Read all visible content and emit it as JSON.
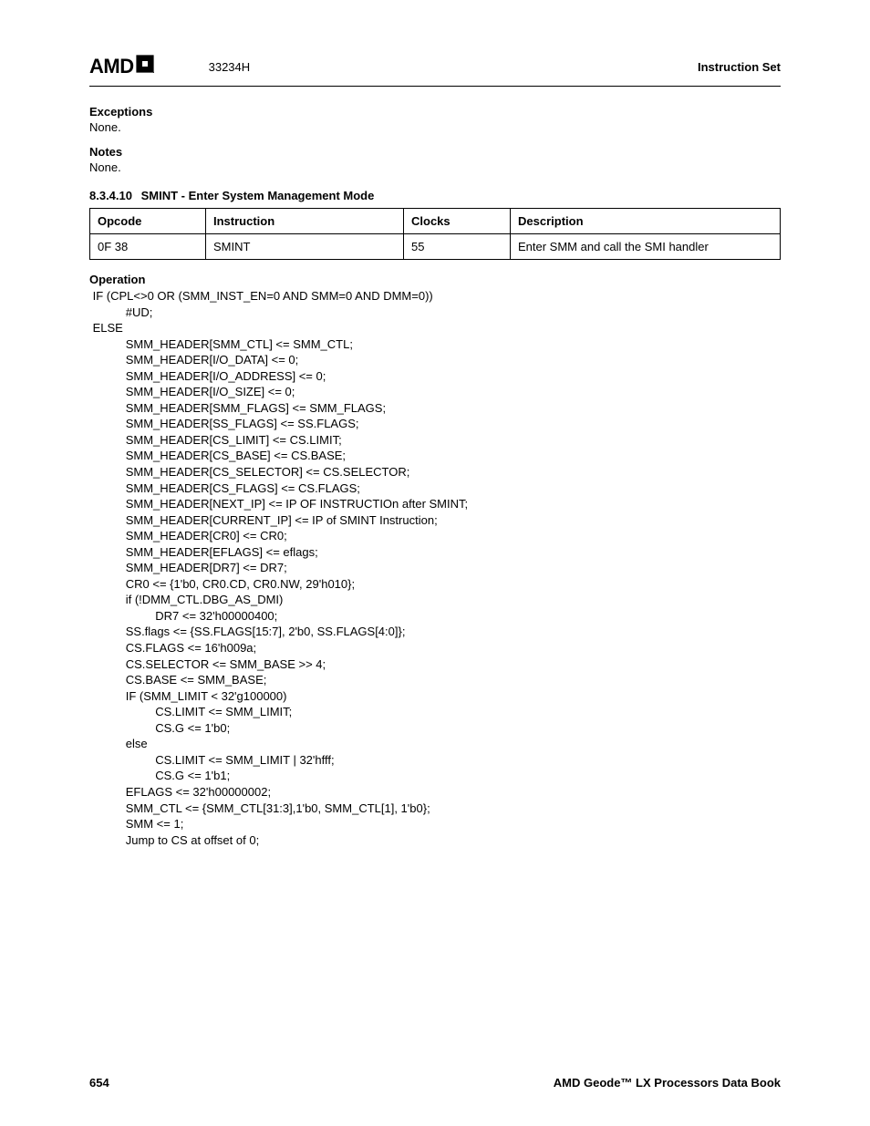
{
  "header": {
    "logo_text": "AMD",
    "doc_code": "33234H",
    "right": "Instruction Set"
  },
  "exceptions": {
    "heading": "Exceptions",
    "text": "None."
  },
  "notes": {
    "heading": "Notes",
    "text": "None."
  },
  "section": {
    "number": "8.3.4.10",
    "title": "SMINT - Enter System Management Mode"
  },
  "table": {
    "headers": {
      "opcode": "Opcode",
      "instruction": "Instruction",
      "clocks": "Clocks",
      "description": "Description"
    },
    "row": {
      "opcode": "0F 38",
      "instruction": "SMINT",
      "clocks": "55",
      "description": "Enter SMM and call the SMI handler"
    }
  },
  "operation": {
    "heading": "Operation",
    "code": " IF (CPL<>0 OR (SMM_INST_EN=0 AND SMM=0 AND DMM=0))\n           #UD;\n ELSE\n           SMM_HEADER[SMM_CTL] <= SMM_CTL;\n           SMM_HEADER[I/O_DATA] <= 0;\n           SMM_HEADER[I/O_ADDRESS] <= 0;\n           SMM_HEADER[I/O_SIZE] <= 0;\n           SMM_HEADER[SMM_FLAGS] <= SMM_FLAGS;\n           SMM_HEADER[SS_FLAGS] <= SS.FLAGS;\n           SMM_HEADER[CS_LIMIT] <= CS.LIMIT;\n           SMM_HEADER[CS_BASE] <= CS.BASE;\n           SMM_HEADER[CS_SELECTOR] <= CS.SELECTOR;\n           SMM_HEADER[CS_FLAGS] <= CS.FLAGS;\n           SMM_HEADER[NEXT_IP] <= IP OF INSTRUCTIOn after SMINT;\n           SMM_HEADER[CURRENT_IP] <= IP of SMINT Instruction;\n           SMM_HEADER[CR0] <= CR0;\n           SMM_HEADER[EFLAGS] <= eflags;\n           SMM_HEADER[DR7] <= DR7;\n           CR0 <= {1'b0, CR0.CD, CR0.NW, 29'h010};\n           if (!DMM_CTL.DBG_AS_DMI)\n                    DR7 <= 32'h00000400;\n           SS.flags <= {SS.FLAGS[15:7], 2'b0, SS.FLAGS[4:0]};\n           CS.FLAGS <= 16'h009a;\n           CS.SELECTOR <= SMM_BASE >> 4;\n           CS.BASE <= SMM_BASE;\n           IF (SMM_LIMIT < 32'g100000)\n                    CS.LIMIT <= SMM_LIMIT;\n                    CS.G <= 1'b0;\n           else\n                    CS.LIMIT <= SMM_LIMIT | 32'hfff;\n                    CS.G <= 1'b1;\n           EFLAGS <= 32'h00000002;\n           SMM_CTL <= {SMM_CTL[31:3],1'b0, SMM_CTL[1], 1'b0};\n           SMM <= 1;\n           Jump to CS at offset of 0;"
  },
  "footer": {
    "page": "654",
    "book": "AMD Geode™ LX Processors Data Book"
  }
}
